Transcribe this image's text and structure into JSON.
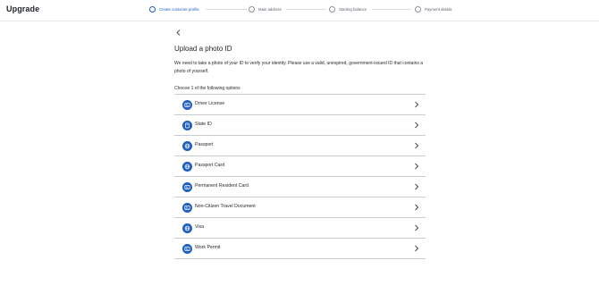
{
  "app": {
    "brand": "Upgrade"
  },
  "stepper": {
    "steps": [
      {
        "label": "Create customer profile",
        "active": true
      },
      {
        "label": "Main address",
        "active": false
      },
      {
        "label": "Starting balance",
        "active": false
      },
      {
        "label": "Payment details",
        "active": false
      }
    ]
  },
  "page": {
    "title": "Upload a photo ID",
    "description": "We need to take a photo of your ID to verify your identity. Please use a valid, unexpired, government-issued ID that contains a photo of yourself.",
    "choose_label": "Choose 1 of the following options"
  },
  "options": [
    {
      "label": "Driver License",
      "icon": "id-card-icon"
    },
    {
      "label": "State ID",
      "icon": "badge-icon"
    },
    {
      "label": "Passport",
      "icon": "globe-icon"
    },
    {
      "label": "Passport Card",
      "icon": "globe-icon"
    },
    {
      "label": "Permanent Resident Card",
      "icon": "id-card-icon"
    },
    {
      "label": "Non-Citizen Travel Document",
      "icon": "id-card-icon"
    },
    {
      "label": "Visa",
      "icon": "globe-icon"
    },
    {
      "label": "Work Permit",
      "icon": "id-card-icon"
    }
  ],
  "colors": {
    "accent": "#1a5fc9",
    "icon_bg": "#1e5fc2",
    "divider": "#c8ccd1"
  }
}
